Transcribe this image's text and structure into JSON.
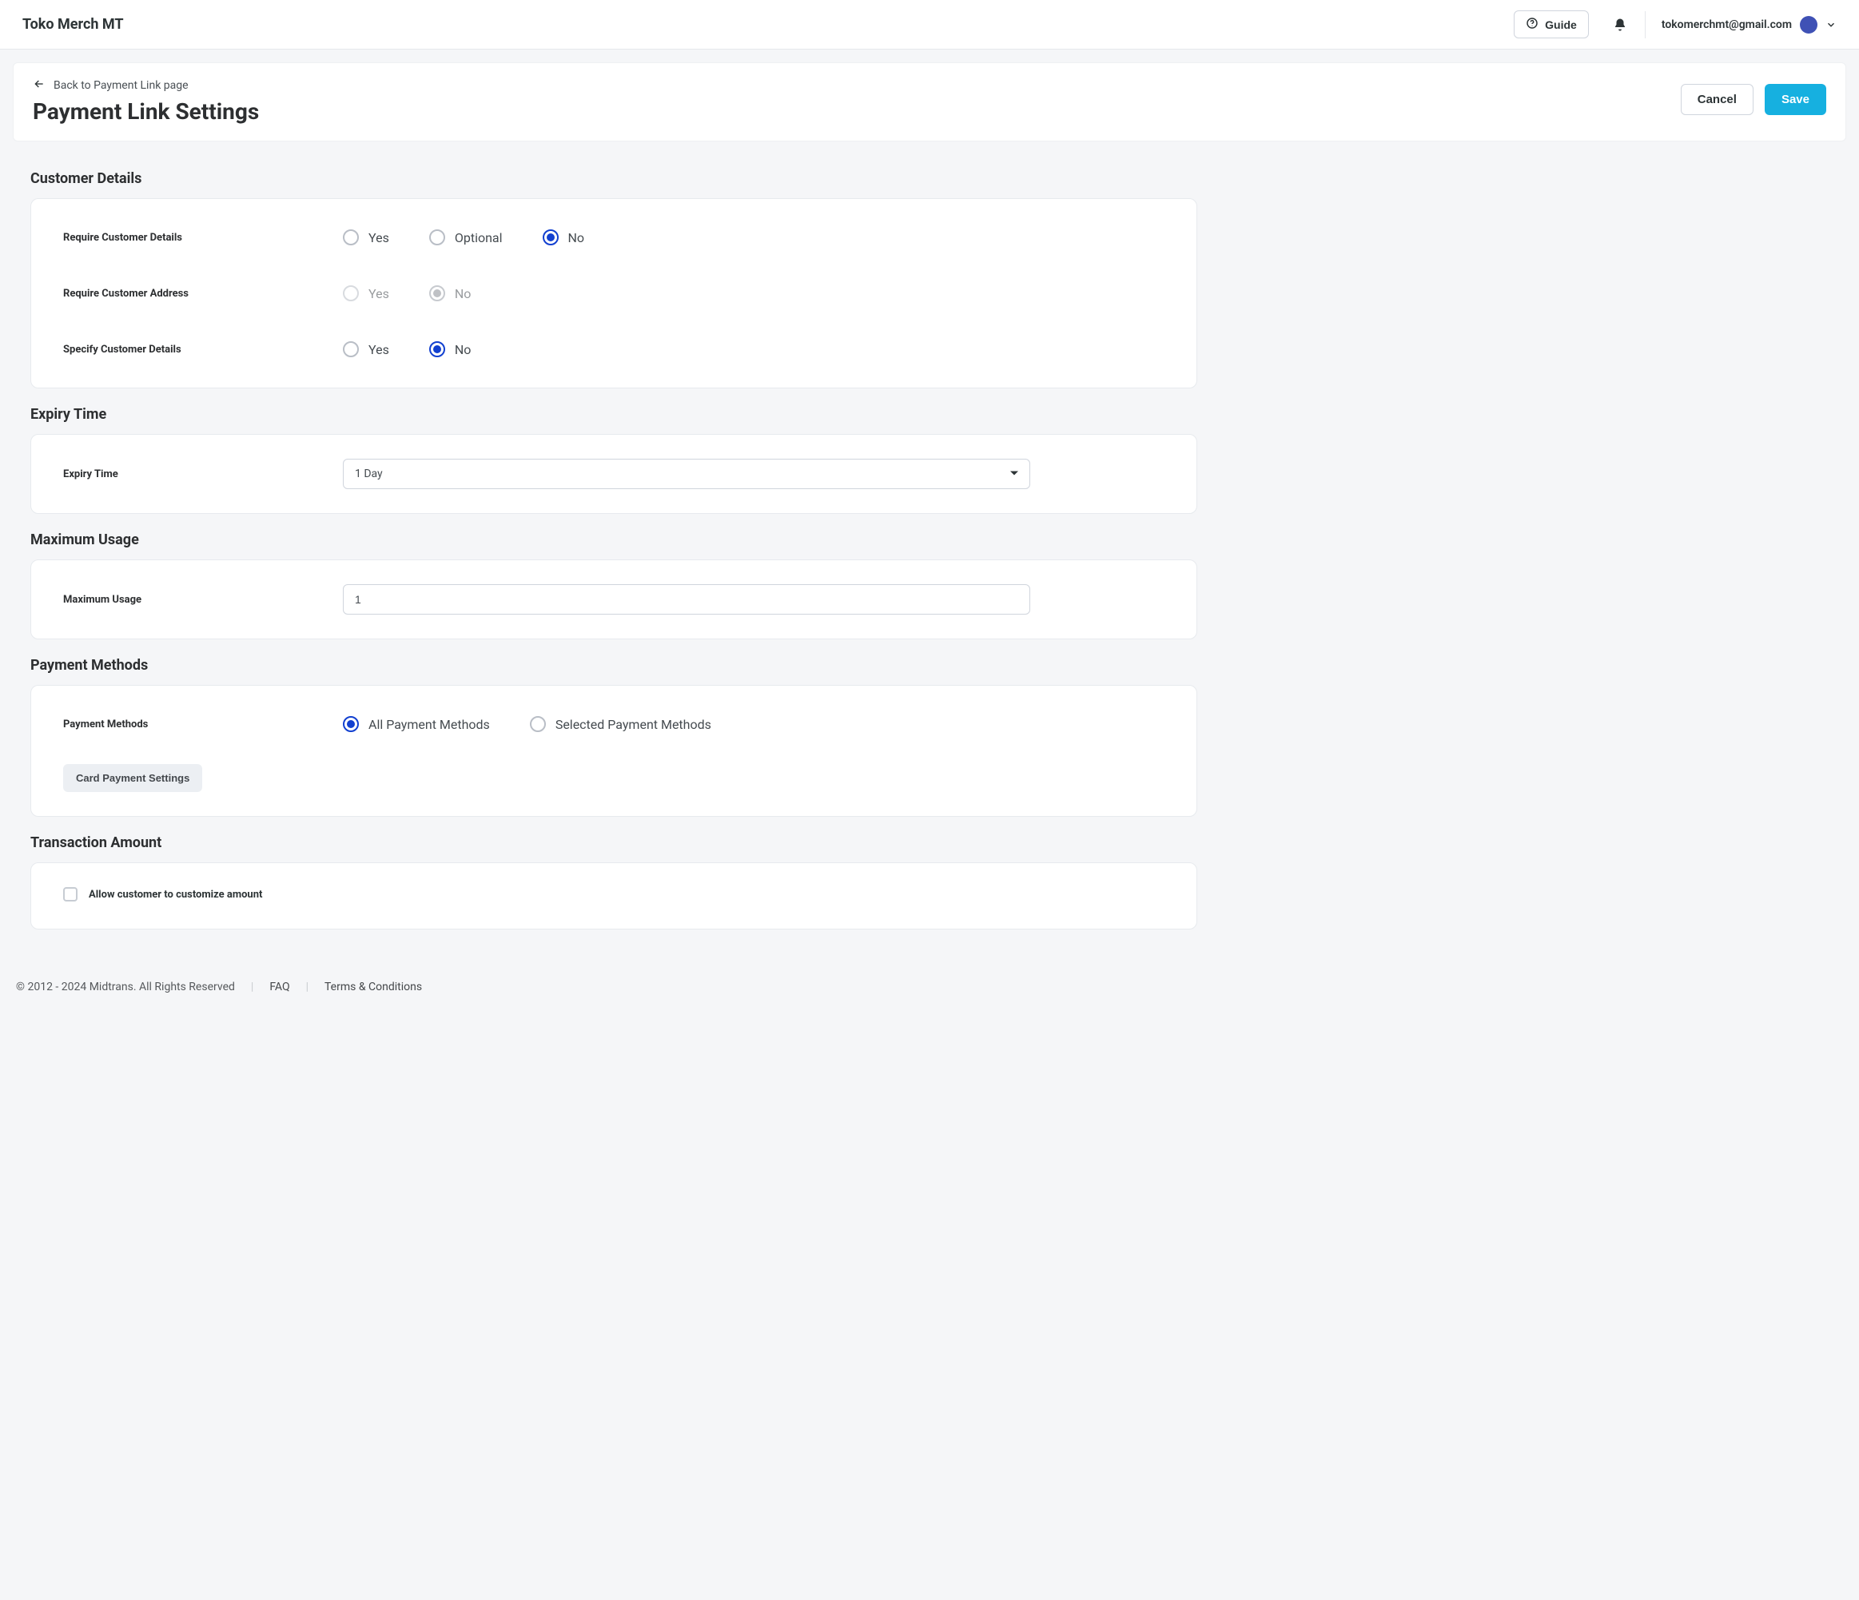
{
  "header": {
    "app_title": "Toko Merch MT",
    "guide_label": "Guide",
    "user_email": "tokomerchmt@gmail.com"
  },
  "page": {
    "back_label": "Back to Payment Link page",
    "title": "Payment Link Settings",
    "cancel_label": "Cancel",
    "save_label": "Save"
  },
  "sections": {
    "customer_details": {
      "title": "Customer Details",
      "fields": {
        "require_details": {
          "label": "Require Customer Details",
          "options": {
            "yes": "Yes",
            "optional": "Optional",
            "no": "No"
          },
          "selected": "no"
        },
        "require_address": {
          "label": "Require Customer Address",
          "options": {
            "yes": "Yes",
            "no": "No"
          },
          "selected": "no",
          "disabled": true
        },
        "specify_details": {
          "label": "Specify Customer Details",
          "options": {
            "yes": "Yes",
            "no": "No"
          },
          "selected": "no"
        }
      }
    },
    "expiry": {
      "title": "Expiry Time",
      "field_label": "Expiry Time",
      "selected_value": "1 Day"
    },
    "max_usage": {
      "title": "Maximum Usage",
      "field_label": "Maximum Usage",
      "value": "1"
    },
    "payment_methods": {
      "title": "Payment Methods",
      "field_label": "Payment Methods",
      "options": {
        "all": "All Payment Methods",
        "selected": "Selected Payment Methods"
      },
      "selected": "all",
      "card_settings_label": "Card Payment Settings"
    },
    "transaction_amount": {
      "title": "Transaction Amount",
      "checkbox_label": "Allow customer to customize amount",
      "checked": false
    }
  },
  "footer": {
    "copyright": "© 2012 - 2024 Midtrans. All Rights Reserved",
    "faq": "FAQ",
    "terms": "Terms & Conditions"
  }
}
